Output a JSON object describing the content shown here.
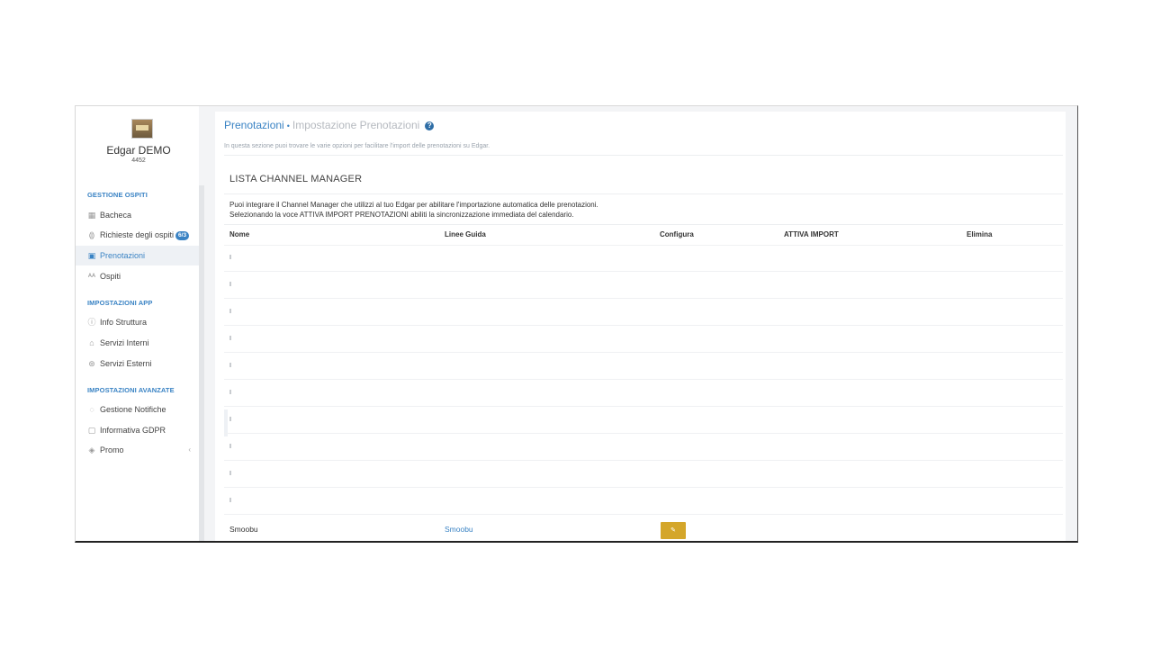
{
  "user": {
    "name": "Edgar DEMO",
    "id": "4452"
  },
  "sidebar": {
    "sections": [
      {
        "title": "GESTIONE OSPITI"
      },
      {
        "title": "IMPOSTAZIONI APP"
      },
      {
        "title": "IMPOSTAZIONI AVANZATE"
      }
    ],
    "items": [
      {
        "label": "Bacheca",
        "icon": "dashboard-icon"
      },
      {
        "label": "Richieste degli ospiti",
        "icon": "requests-icon",
        "badge": "6/3"
      },
      {
        "label": "Prenotazioni",
        "icon": "calendar-icon"
      },
      {
        "label": "Ospiti",
        "icon": "guests-icon"
      },
      {
        "label": "Info Struttura",
        "icon": "info-icon"
      },
      {
        "label": "Servizi Interni",
        "icon": "bell-icon"
      },
      {
        "label": "Servizi Esterni",
        "icon": "external-icon"
      },
      {
        "label": "Gestione Notifiche",
        "icon": "notification-icon"
      },
      {
        "label": "Informativa GDPR",
        "icon": "lock-icon"
      },
      {
        "label": "Promo",
        "icon": "tag-icon"
      }
    ]
  },
  "main": {
    "breadcrumb": {
      "current": "Prenotazioni",
      "separator": "•",
      "page": "Impostazione Prenotazioni",
      "help": "?"
    },
    "subtitle": "In questa sezione puoi trovare le varie opzioni per facilitare l'import delle prenotazioni su Edgar.",
    "section_title": "LISTA CHANNEL MANAGER",
    "description_1": "Puoi integrare il Channel Manager che utilizzi al tuo Edgar per abilitare l'importazione automatica delle prenotazioni.",
    "description_2": "Selezionando la voce ATTIVA IMPORT PRENOTAZIONI abiliti la sincronizzazione immediata del calendario.",
    "table": {
      "headers": [
        "Nome",
        "Linee Guida",
        "Configura",
        "ATTIVA IMPORT",
        "Elimina"
      ],
      "rows": [
        {
          "name": "Smoobu",
          "guide": "Smoobu",
          "config_icon": "edit-icon"
        }
      ]
    }
  },
  "colors": {
    "accent": "#3a83c4",
    "config_button": "#d4a62a"
  }
}
